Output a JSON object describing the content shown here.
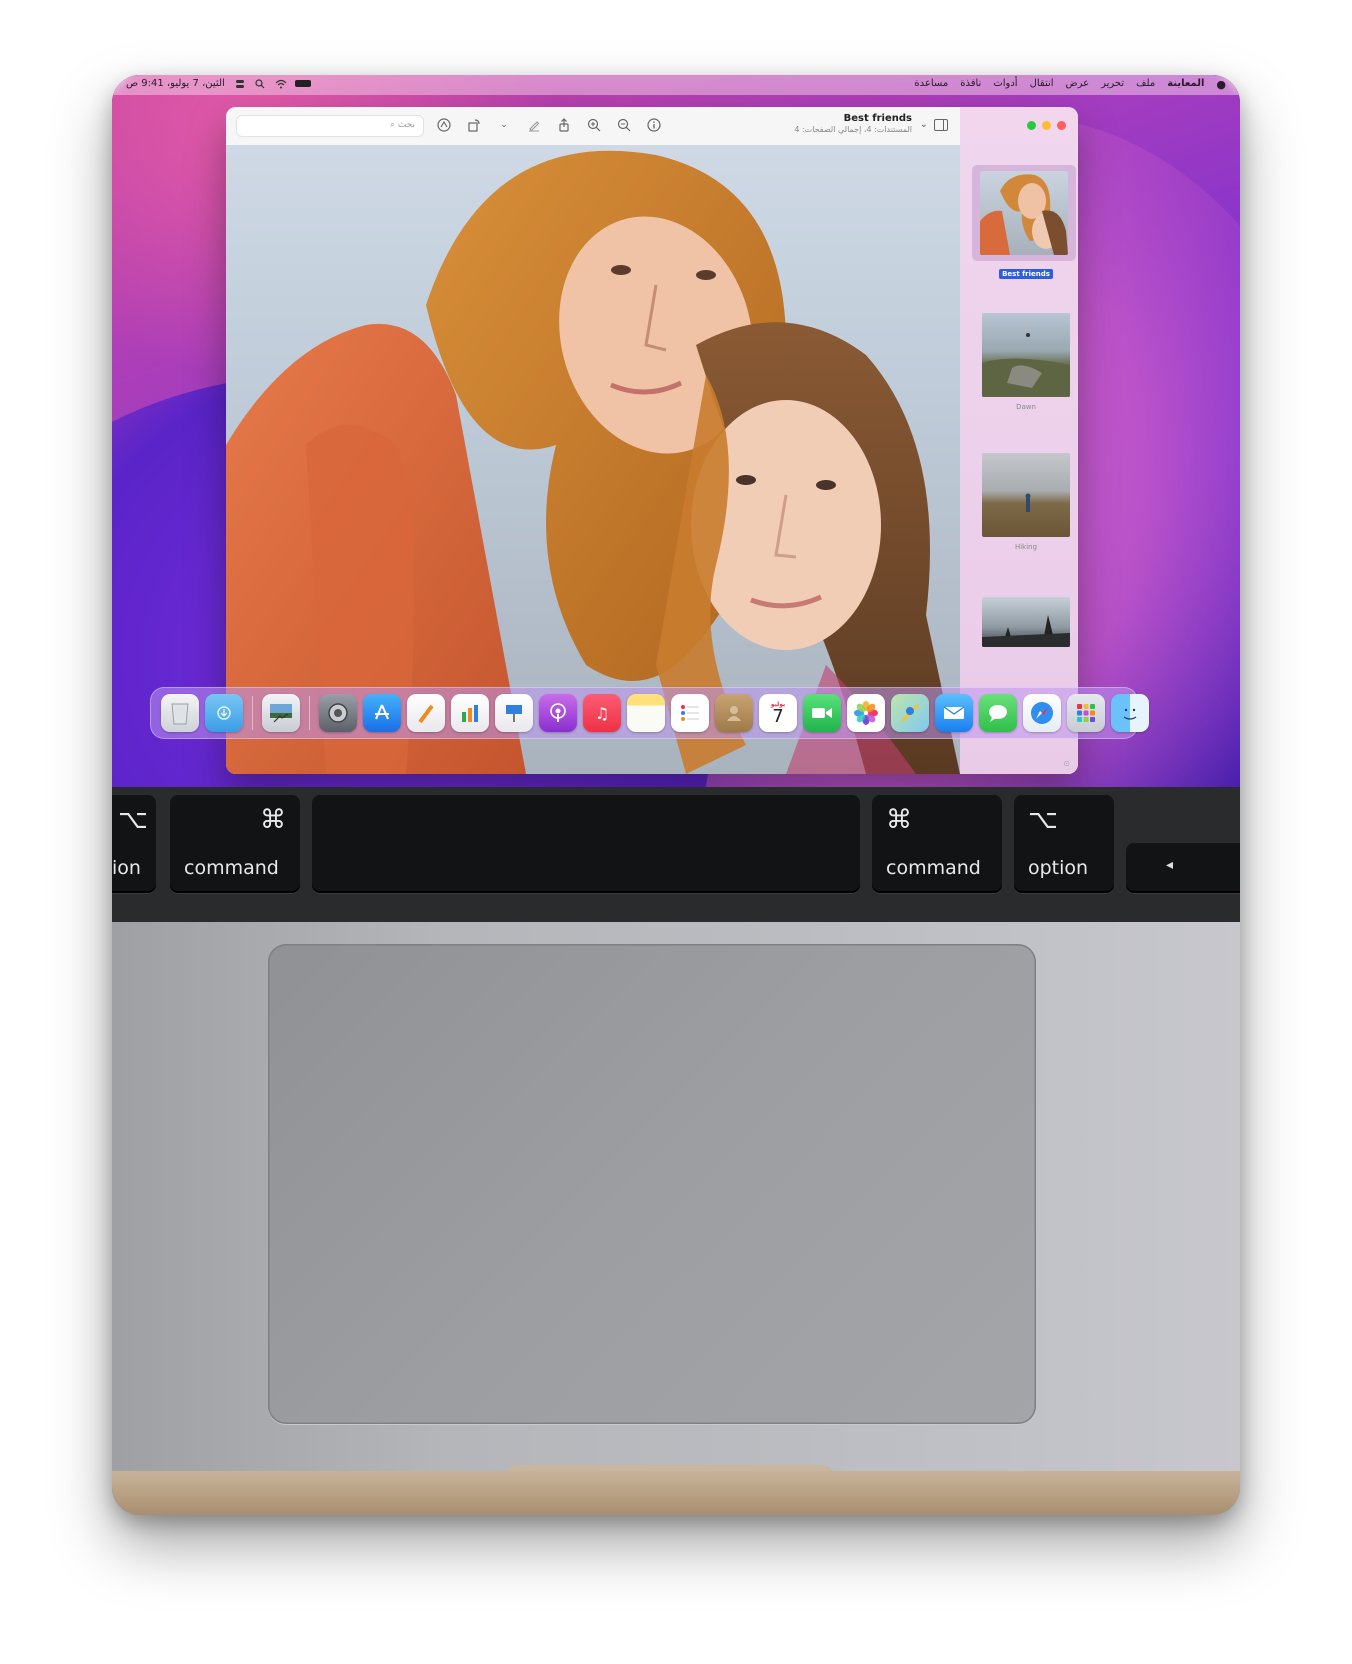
{
  "menubar": {
    "app_name": "المعاينة",
    "items": [
      "ملف",
      "تحرير",
      "عرض",
      "انتقال",
      "أدوات",
      "نافذة",
      "مساعدة"
    ],
    "datetime": "الثين، 7 يوليو، 9:41 ص"
  },
  "window": {
    "title": "Best friends",
    "subtitle": "المستندات: 4، إجمالي الصفحات: 4",
    "search_placeholder": "بحث"
  },
  "sidebar": {
    "thumbnails": [
      {
        "label": "Best friends",
        "selected": true
      },
      {
        "label": "Dawn",
        "selected": false
      },
      {
        "label": "Hiking",
        "selected": false
      },
      {
        "label": "",
        "selected": false
      }
    ]
  },
  "dock": {
    "icons": [
      "trash-icon",
      "downloads-folder-icon",
      "preview-icon",
      "system-preferences-icon",
      "app-store-icon",
      "pages-icon",
      "numbers-icon",
      "keynote-icon",
      "podcasts-icon",
      "music-icon",
      "notes-icon",
      "reminders-icon",
      "contacts-icon",
      "calendar-icon",
      "facetime-icon",
      "photos-icon",
      "maps-icon",
      "mail-icon",
      "messages-icon",
      "safari-icon",
      "launchpad-icon",
      "finder-icon"
    ],
    "calendar_day": "7",
    "calendar_month": "يوليو"
  },
  "keyboard": {
    "left_option_partial": "ion",
    "left_command": "command",
    "right_command": "command",
    "right_option": "option",
    "command_symbol": "⌘",
    "option_symbol": "⌥"
  },
  "colors": {
    "accent": "#2b5fe0",
    "traffic_close": "#ff5f57",
    "traffic_min": "#febc2e",
    "traffic_max": "#28c840"
  }
}
